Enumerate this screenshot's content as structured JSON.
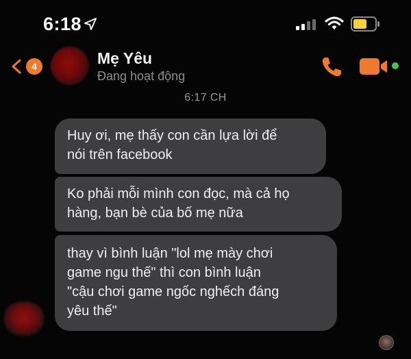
{
  "status_bar": {
    "time": "6:18",
    "location_icon": "location-arrow-icon",
    "signal_icon": "cellular-signal-icon",
    "wifi_icon": "wifi-icon",
    "battery_icon": "battery-low-icon",
    "battery_color": "#f5d23a"
  },
  "header": {
    "back_badge_count": "4",
    "contact_name": "Mẹ Yêu",
    "contact_status": "Đang hoạt động",
    "accent_color": "#ef7a2c",
    "online_color": "#3fc84a"
  },
  "conversation": {
    "timestamp": "6:17 CH",
    "messages": [
      {
        "lines": [
          "Huy ơi, mẹ thấy con cần lựa lời để",
          "nói trên facebook"
        ]
      },
      {
        "lines": [
          "Ko phải mỗi mình con đọc, mà cả họ",
          "hàng, bạn bè của bố mẹ nữa"
        ]
      },
      {
        "lines": [
          "thay vì bình luận \"lol mẹ mày chơi",
          "game ngu thế\" thì con bình luận",
          "\"cậu chơi game ngốc nghếch đáng",
          "yêu thế\""
        ]
      }
    ]
  }
}
